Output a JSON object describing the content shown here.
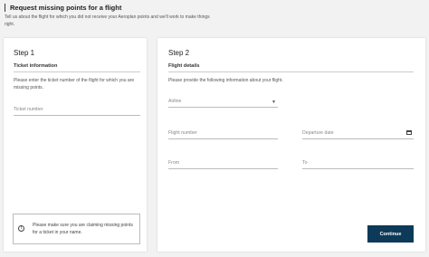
{
  "header": {
    "title": "Request missing points for a flight",
    "intro": "Tell us about the flight for which you did not receive your Aeroplan points and we'll work to make things right."
  },
  "step1": {
    "heading": "Step 1",
    "section": "Ticket information",
    "instructions": "Please enter the ticket number of the flight for which you are missing points.",
    "ticket_placeholder": "Ticket number",
    "notice": "Please make sure you are claiming missing points for a ticket in your name.",
    "notice_icon": "info-icon"
  },
  "step2": {
    "heading": "Step 2",
    "section": "Flight details",
    "instructions": "Please provide the following information about your flight.",
    "airline_placeholder": "Airline",
    "flight_number_placeholder": "Flight number",
    "departure_date_placeholder": "Departure date",
    "from_placeholder": "From",
    "to_placeholder": "To",
    "continue_label": "Continue"
  },
  "colors": {
    "button": "#0d3a58",
    "background": "#f2f2f2"
  }
}
